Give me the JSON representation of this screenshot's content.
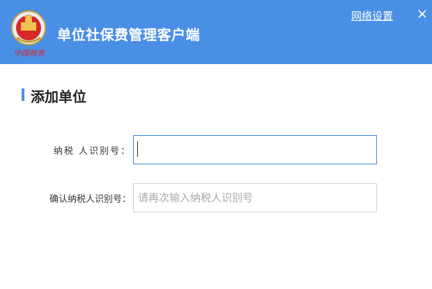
{
  "titlebar": {
    "app_title": "单位社保费管理客户端",
    "network_settings": "网络设置",
    "close_label": "×",
    "colors": {
      "header_bg": "#4a8fe6"
    }
  },
  "section": {
    "title": "添加单位"
  },
  "form": {
    "taxpayer_id": {
      "label": "纳税 人识别号：",
      "value": "",
      "placeholder": ""
    },
    "confirm_taxpayer_id": {
      "label": "确认纳税人识别号：",
      "value": "",
      "placeholder": "请再次输入纳税人识别号"
    }
  }
}
